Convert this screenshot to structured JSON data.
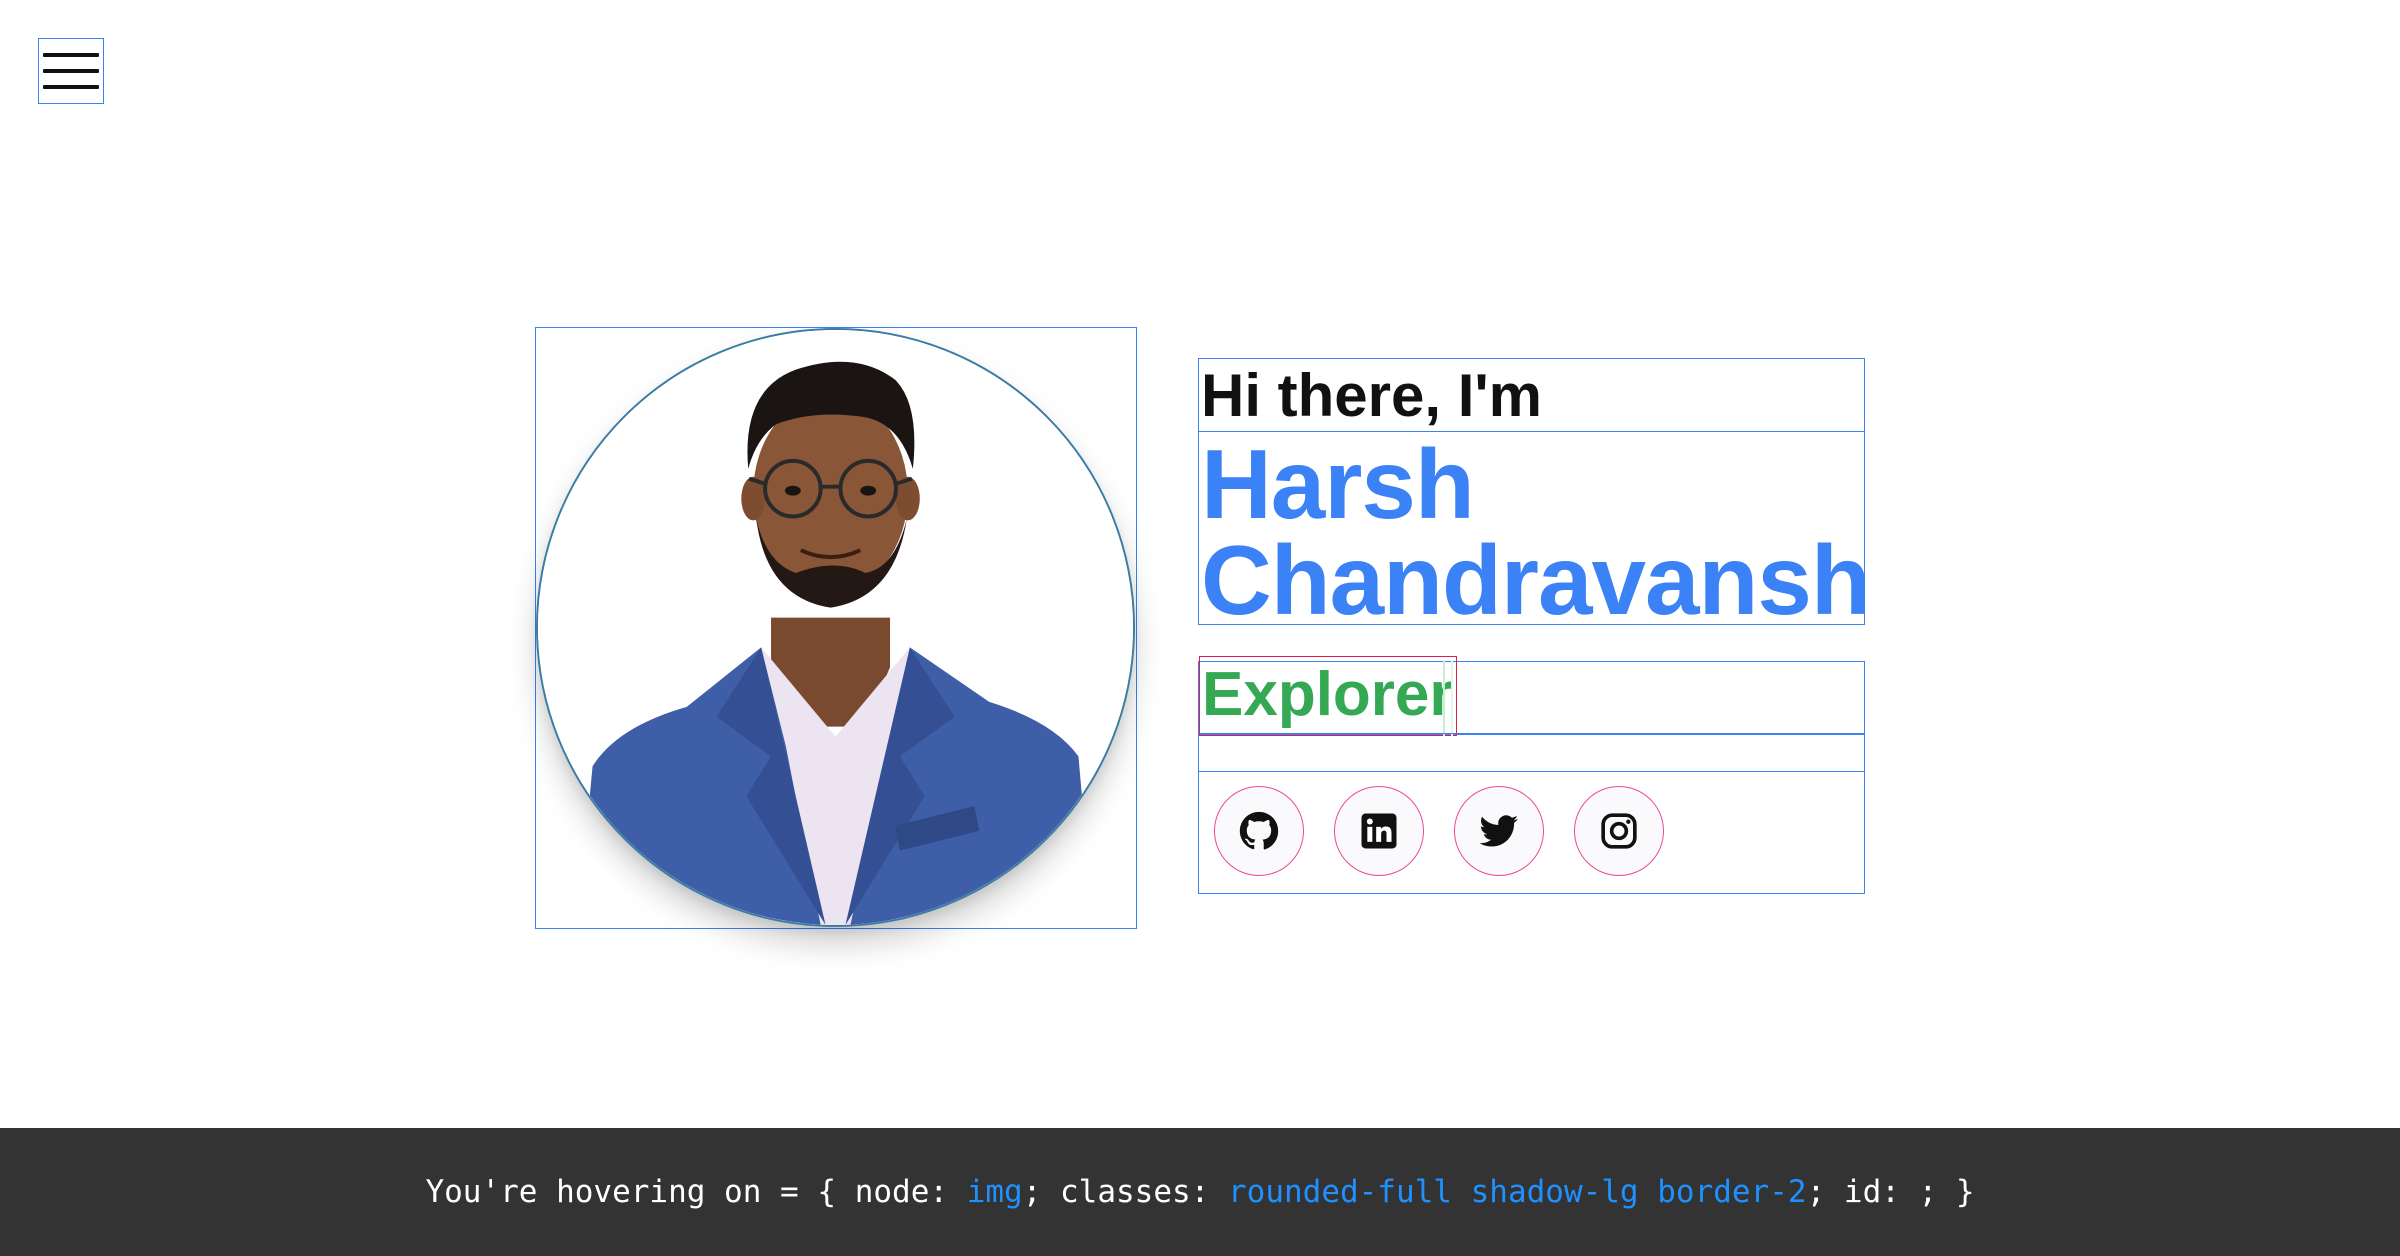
{
  "menu": {
    "icon": "hamburger-menu-icon"
  },
  "profile": {
    "photo_alt": "Harsh Chandravanshi"
  },
  "intro": {
    "greeting": "Hi there, I'm",
    "name_line1": "Harsh",
    "name_line2": "Chandravanshi",
    "role": "Explorer"
  },
  "social": [
    {
      "icon": "github-icon"
    },
    {
      "icon": "linkedin-icon"
    },
    {
      "icon": "twitter-icon"
    },
    {
      "icon": "instagram-icon"
    }
  ],
  "hover_status": {
    "prefix": "You're hovering on = { node: ",
    "node": "img",
    "classes_label": "; classes: ",
    "classes": "rounded-full shadow-lg border-2",
    "id_label": "; id: ; }"
  },
  "colors": {
    "name": "#3b82f6",
    "role": "#34a853",
    "footer_bg": "#333333",
    "footer_highlight": "#1e90ff",
    "social_border": "#ec4899",
    "debug_outline": "#3b82f6"
  }
}
